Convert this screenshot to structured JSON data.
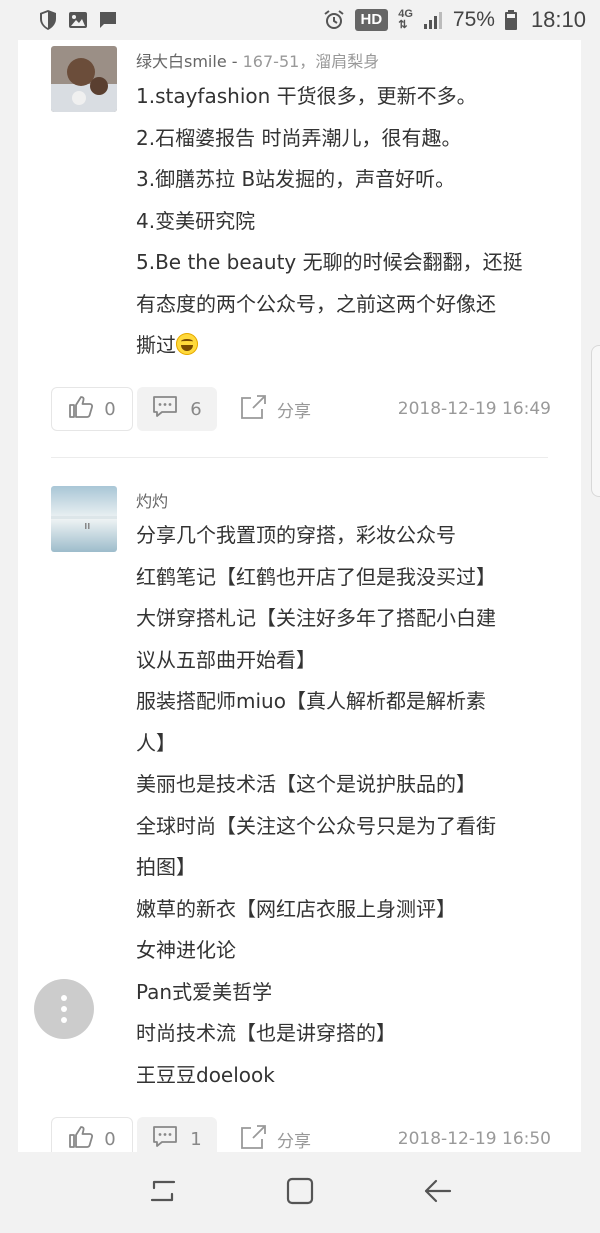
{
  "status_bar": {
    "hd": "HD",
    "network": "4G",
    "battery": "75%",
    "time": "18:10"
  },
  "comments": [
    {
      "author": "绿大白smile",
      "separator": " - ",
      "meta": "167-51，溜肩梨身",
      "lines": [
        "1.stayfashion 干货很多，更新不多。",
        "2.石榴婆报告 时尚弄潮儿，很有趣。",
        "3.御膳苏拉 B站发掘的，声音好听。",
        "4.变美研究院",
        "5.Be the beauty 无聊的时候会翻翻，还挺",
        "有态度的两个公众号，之前这两个好像还",
        "撕过"
      ],
      "likes": "0",
      "replies": "6",
      "share": "分享",
      "timestamp": "2018-12-19 16:49"
    },
    {
      "author": "灼灼",
      "lines": [
        "分享几个我置顶的穿搭，彩妆公众号",
        "红鹤笔记【红鹤也开店了但是我没买过】",
        "大饼穿搭札记【关注好多年了搭配小白建",
        "议从五部曲开始看】",
        "服装搭配师miuo【真人解析都是解析素",
        "人】",
        "美丽也是技术活【这个是说护肤品的】",
        "全球时尚【关注这个公众号只是为了看街",
        "拍图】",
        "嫩草的新衣【网红店衣服上身测评】",
        "女神进化论",
        "Pan式爱美哲学",
        "时尚技术流【也是讲穿搭的】",
        "王豆豆doelook"
      ],
      "likes": "0",
      "replies": "1",
      "share": "分享",
      "timestamp": "2018-12-19 16:50"
    }
  ],
  "icons": {
    "like": "thumbs-up-icon",
    "reply": "comment-icon",
    "share": "share-icon",
    "more": "more-vertical-icon"
  }
}
